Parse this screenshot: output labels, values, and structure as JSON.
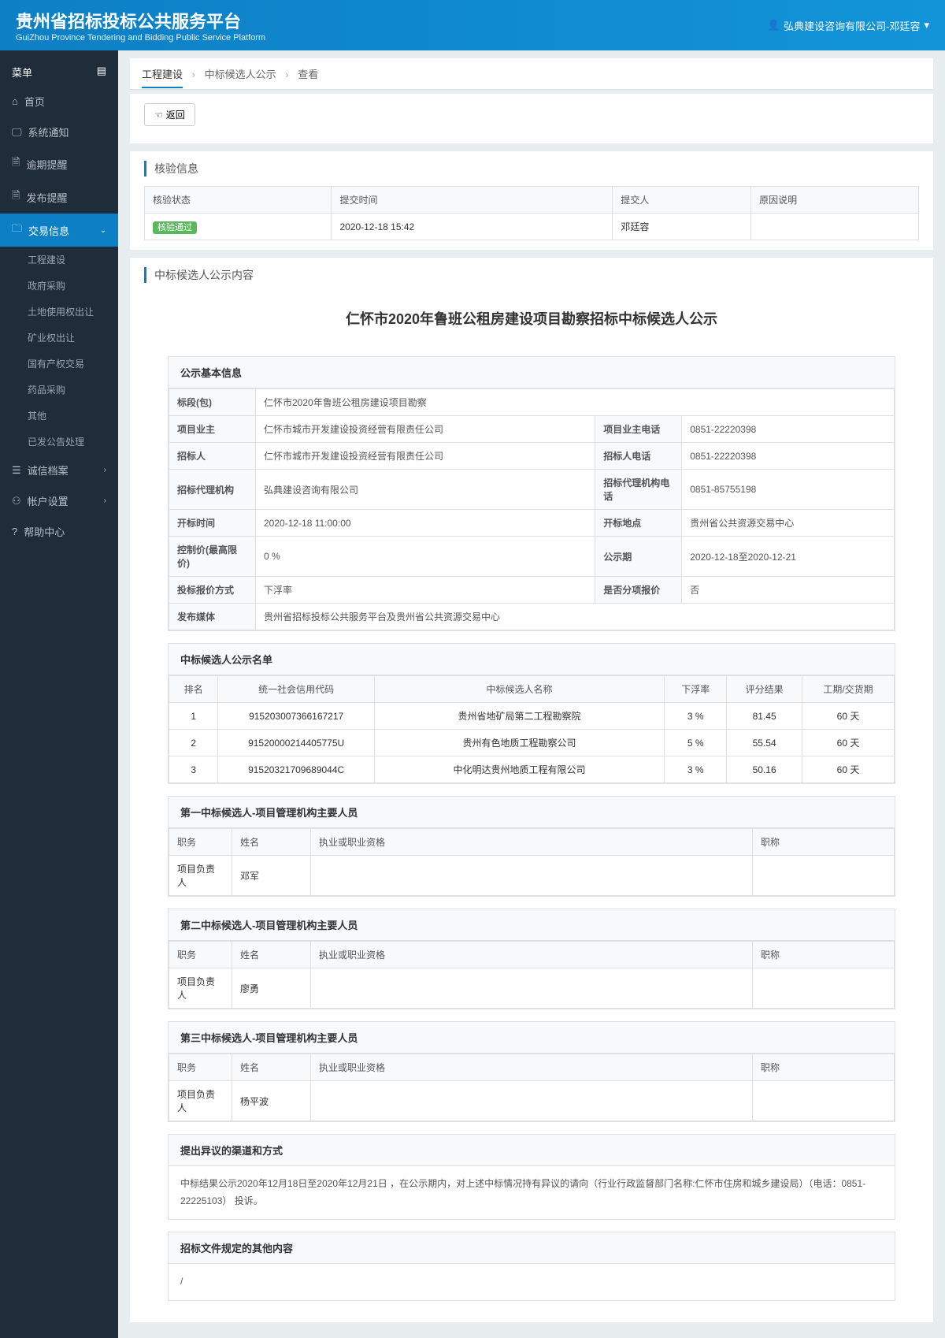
{
  "header": {
    "title_cn": "贵州省招标投标公共服务平台",
    "title_en": "GuiZhou Province Tendering and Bidding Public Service Platform",
    "user": "弘典建设咨询有限公司-邓廷容"
  },
  "sidebar": {
    "menu_label": "菜单",
    "items": [
      {
        "label": "首页"
      },
      {
        "label": "系统通知"
      },
      {
        "label": "逾期提醒"
      },
      {
        "label": "发布提醒"
      },
      {
        "label": "交易信息",
        "active": true,
        "expandable": true
      }
    ],
    "subitems": [
      {
        "label": "工程建设"
      },
      {
        "label": "政府采购"
      },
      {
        "label": "土地使用权出让"
      },
      {
        "label": "矿业权出让"
      },
      {
        "label": "国有产权交易"
      },
      {
        "label": "药品采购"
      },
      {
        "label": "其他"
      },
      {
        "label": "已发公告处理"
      }
    ],
    "items2": [
      {
        "label": "诚信档案",
        "chev": true
      },
      {
        "label": "帐户设置",
        "chev": true
      },
      {
        "label": "帮助中心"
      }
    ]
  },
  "breadcrumb": {
    "a": "工程建设",
    "b": "中标候选人公示",
    "c": "查看"
  },
  "return_btn": "返回",
  "verify": {
    "title": "核验信息",
    "headers": {
      "status": "核验状态",
      "time": "提交时间",
      "submitter": "提交人",
      "reason": "原因说明"
    },
    "row": {
      "status": "核验通过",
      "time": "2020-12-18 15:42",
      "submitter": "邓廷容",
      "reason": ""
    }
  },
  "content_title": "中标候选人公示内容",
  "announce_title": "仁怀市2020年鲁班公租房建设项目勘察招标中标候选人公示",
  "basic": {
    "title": "公示基本信息",
    "rows": {
      "section_label": "标段(包)",
      "section_value": "仁怀市2020年鲁班公租房建设项目勘察",
      "owner_label": "项目业主",
      "owner_value": "仁怀市城市开发建设投资经营有限责任公司",
      "owner_tel_label": "项目业主电话",
      "owner_tel_value": "0851-22220398",
      "tenderer_label": "招标人",
      "tenderer_value": "仁怀市城市开发建设投资经营有限责任公司",
      "tenderer_tel_label": "招标人电话",
      "tenderer_tel_value": "0851-22220398",
      "agency_label": "招标代理机构",
      "agency_value": "弘典建设咨询有限公司",
      "agency_tel_label": "招标代理机构电话",
      "agency_tel_value": "0851-85755198",
      "open_time_label": "开标时间",
      "open_time_value": "2020-12-18 11:00:00",
      "open_place_label": "开标地点",
      "open_place_value": "贵州省公共资源交易中心",
      "ctrl_label": "控制价(最高限价)",
      "ctrl_value": "0 %",
      "period_label": "公示期",
      "period_value": "2020-12-18至2020-12-21",
      "quote_label": "投标报价方式",
      "quote_value": "下浮率",
      "split_label": "是否分项报价",
      "split_value": "否",
      "media_label": "发布媒体",
      "media_value": "贵州省招标投标公共服务平台及贵州省公共资源交易中心"
    }
  },
  "candidates": {
    "title": "中标候选人公示名单",
    "headers": {
      "rank": "排名",
      "code": "统一社会信用代码",
      "name": "中标候选人名称",
      "rate": "下浮率",
      "score": "评分结果",
      "period": "工期/交货期"
    },
    "rows": [
      {
        "rank": "1",
        "code": "915203007366167217",
        "name": "贵州省地矿局第二工程勘察院",
        "rate": "3 %",
        "score": "81.45",
        "period": "60 天"
      },
      {
        "rank": "2",
        "code": "91520000214405775U",
        "name": "贵州有色地质工程勘察公司",
        "rate": "5 %",
        "score": "55.54",
        "period": "60 天"
      },
      {
        "rank": "3",
        "code": "91520321709689044C",
        "name": "中化明达贵州地质工程有限公司",
        "rate": "3 %",
        "score": "50.16",
        "period": "60 天"
      }
    ]
  },
  "staff": [
    {
      "title": "第一中标候选人-项目管理机构主要人员",
      "h": {
        "duty": "职务",
        "name": "姓名",
        "qual": "执业或职业资格",
        "title": "职称"
      },
      "row": {
        "duty": "项目负责人",
        "name": "邓军",
        "qual": "",
        "title": ""
      }
    },
    {
      "title": "第二中标候选人-项目管理机构主要人员",
      "h": {
        "duty": "职务",
        "name": "姓名",
        "qual": "执业或职业资格",
        "title": "职称"
      },
      "row": {
        "duty": "项目负责人",
        "name": "廖勇",
        "qual": "",
        "title": ""
      }
    },
    {
      "title": "第三中标候选人-项目管理机构主要人员",
      "h": {
        "duty": "职务",
        "name": "姓名",
        "qual": "执业或职业资格",
        "title": "职称"
      },
      "row": {
        "duty": "项目负责人",
        "name": "杨平波",
        "qual": "",
        "title": ""
      }
    }
  ],
  "objection": {
    "title": "提出异议的渠道和方式",
    "text": "中标结果公示2020年12月18日至2020年12月21日 ，在公示期内，对上述中标情况持有异议的请向（行业行政监督部门名称:仁怀市住房和城乡建设局）（电话：0851-22225103） 投诉。"
  },
  "other": {
    "title": "招标文件规定的其他内容",
    "text": "/"
  }
}
